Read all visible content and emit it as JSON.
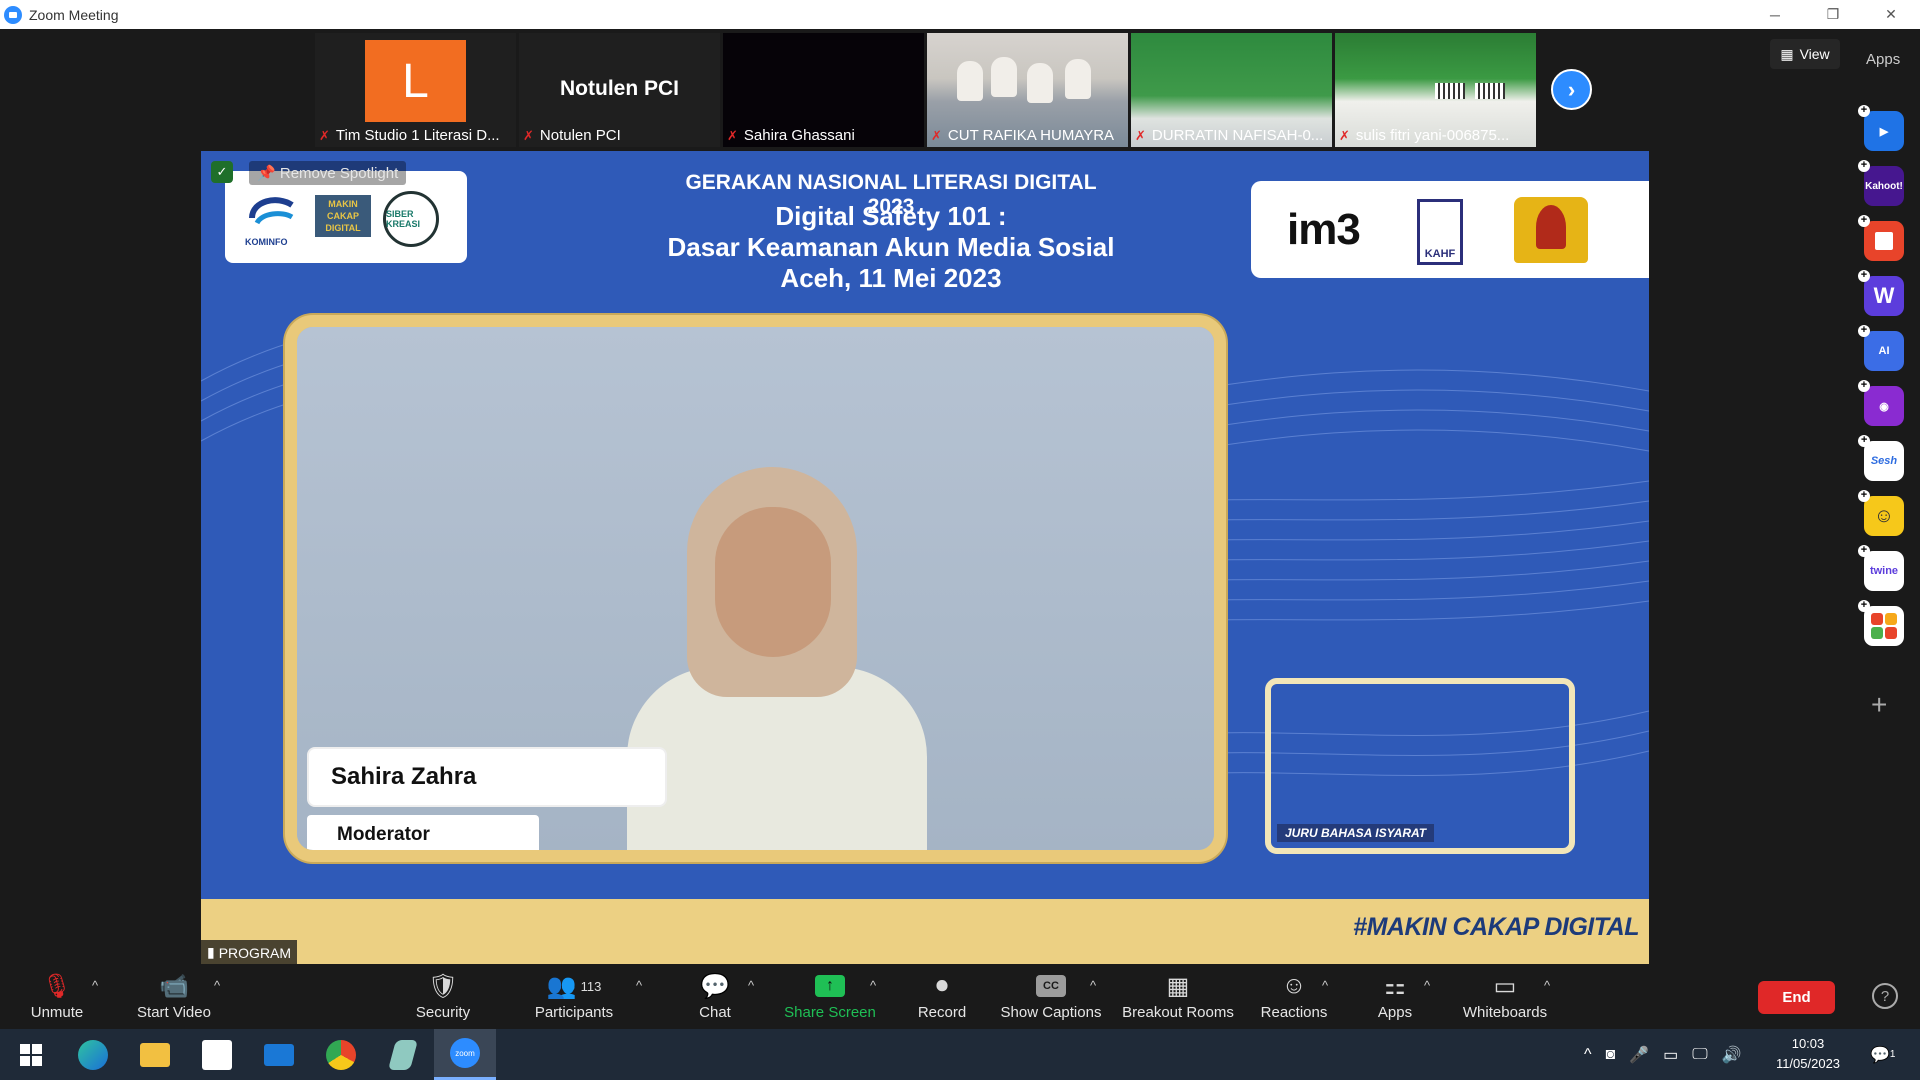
{
  "window": {
    "title": "Zoom Meeting",
    "controls": [
      "─",
      "❐",
      "✕"
    ]
  },
  "gallery": {
    "tiles": [
      {
        "name": "Tim Studio 1 Literasi D...",
        "avatar_letter": "L",
        "muted": true
      },
      {
        "name": "Notulen PCI",
        "display_name": "Notulen PCI",
        "muted": true
      },
      {
        "name": "Sahira Ghassani",
        "muted": true
      },
      {
        "name": "CUT RAFIKA HUMAYRA",
        "muted": true
      },
      {
        "name": "DURRATIN NAFISAH-0...",
        "muted": true
      },
      {
        "name": "sulis fitri yani-006875...",
        "muted": true
      }
    ],
    "next_symbol": "›"
  },
  "view_button": {
    "label": "View",
    "icon": "grid-icon"
  },
  "apps_label": "Apps",
  "side_apps": [
    {
      "name": "kahoot-like-arrow",
      "label": "",
      "color": "#1f73e6"
    },
    {
      "name": "kahoot",
      "label": "Kahoot!",
      "color": "#46178f"
    },
    {
      "name": "red-app",
      "label": "",
      "color": "#e8442a"
    },
    {
      "name": "wooclap",
      "label": "W",
      "color": "#5c3ddc"
    },
    {
      "name": "ai-app",
      "label": "AI",
      "color": "#3b6de6"
    },
    {
      "name": "video-app",
      "label": "",
      "color": "#8a2bd1"
    },
    {
      "name": "sesh",
      "label": "Sesh",
      "color": "#ffffff"
    },
    {
      "name": "emoji-app",
      "label": "",
      "color": "#f6c81a"
    },
    {
      "name": "twine",
      "label": "twine",
      "color": "#ffffff"
    },
    {
      "name": "grid-app",
      "label": "",
      "color": "#ffffff"
    }
  ],
  "stage": {
    "spotlight_label": "Remove Spotlight",
    "event_title": "GERAKAN NASIONAL LITERASI DIGITAL 2023",
    "session_title_1": "Digital Safety 101 :",
    "session_title_2": "Dasar Keamanan Akun Media Sosial",
    "session_title_3": "Aceh, 11 Mei 2023",
    "left_logos": {
      "kominfo": "KOMINFO",
      "makin_cakap": "MAKIN CAKAP DIGITAL",
      "siberkreasi": "SIBER KREASI"
    },
    "right_logos": {
      "im3": "im3",
      "kahf": "KAHF"
    },
    "speaker_name": "Sahira Zahra",
    "speaker_role": "Moderator",
    "sign_interpreter_label": "JURU BAHASA ISYARAT",
    "hashtag": "#MAKIN CAKAP DIGITAL",
    "program_label": "PROGRAM"
  },
  "toolbar": {
    "unmute": "Unmute",
    "start_video": "Start Video",
    "security": "Security",
    "participants": "Participants",
    "participant_count": "113",
    "chat": "Chat",
    "share_screen": "Share Screen",
    "record": "Record",
    "show_captions": "Show Captions",
    "captions_icon_text": "CC",
    "breakout_rooms": "Breakout Rooms",
    "reactions": "Reactions",
    "apps": "Apps",
    "whiteboards": "Whiteboards",
    "end": "End",
    "help": "?",
    "more": "⋮",
    "caret": "^"
  },
  "taskbar": {
    "time": "10:03",
    "date": "11/05/2023",
    "notification_count": "1",
    "zoom_label": "zoom"
  }
}
